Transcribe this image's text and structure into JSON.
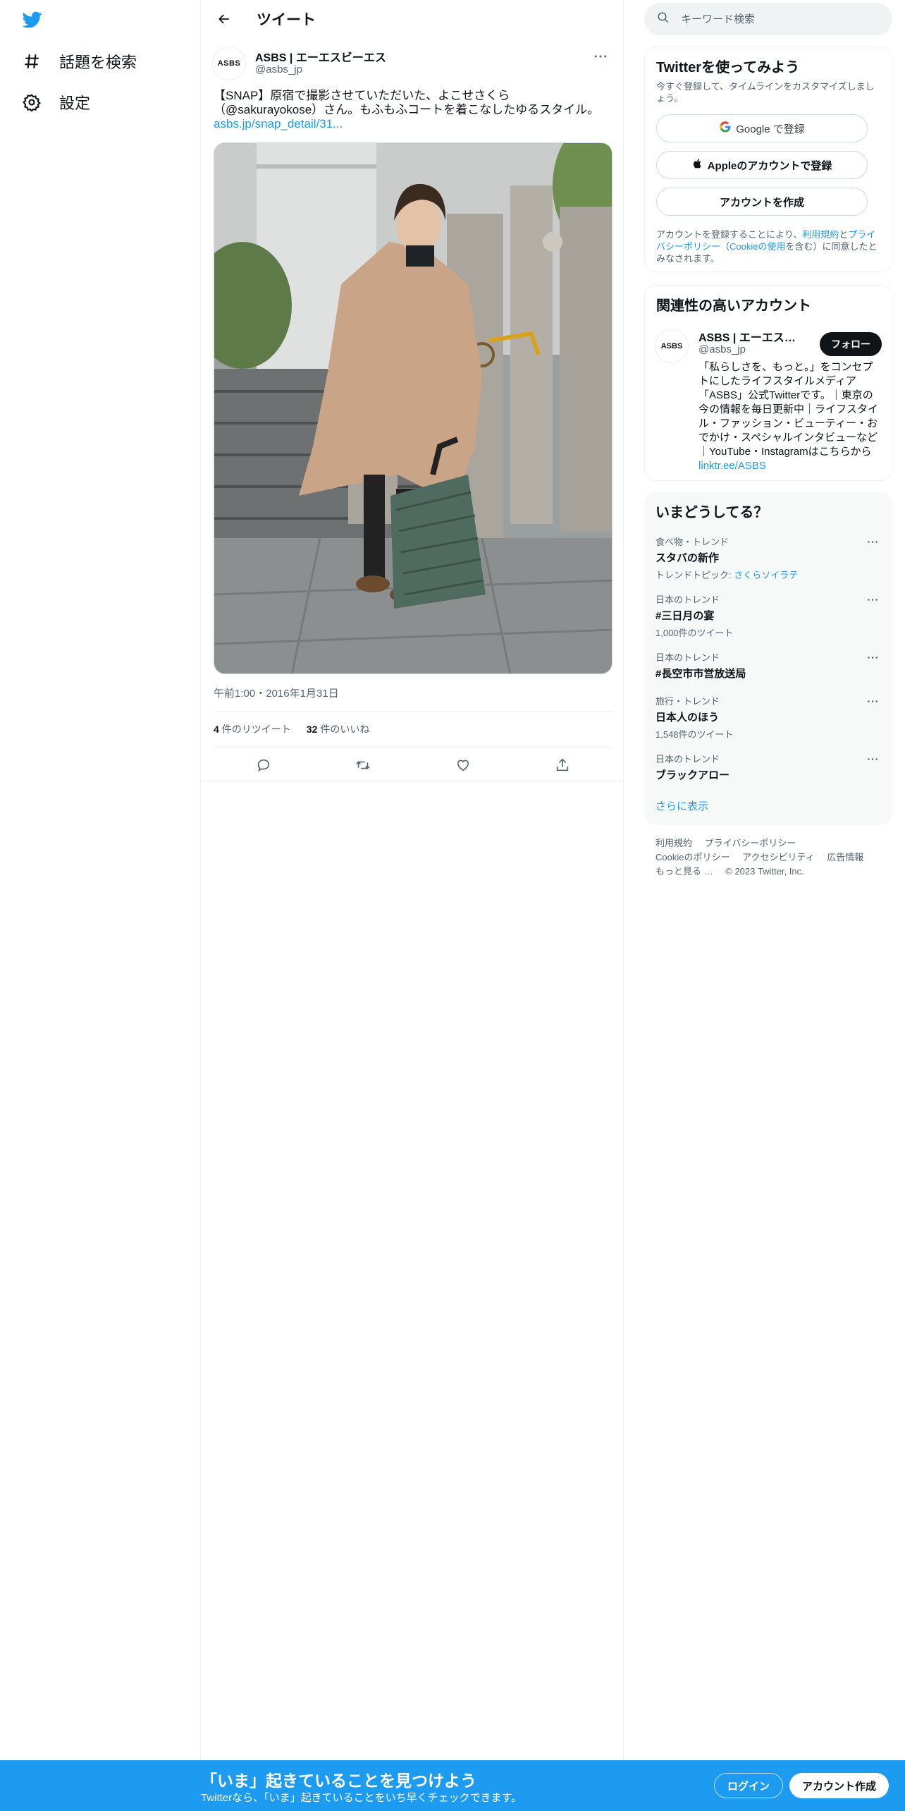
{
  "nav": {
    "items": [
      {
        "label": "話題を検索",
        "icon": "hashtag-icon"
      },
      {
        "label": "設定",
        "icon": "gear-icon"
      }
    ]
  },
  "header": {
    "title": "ツイート"
  },
  "tweet": {
    "author_name": "ASBS | エーエスビーエス",
    "author_handle": "@asbs_jp",
    "avatar_text": "ASBS",
    "text": "【SNAP】原宿で撮影させていただいた、よこせさくら（@sakurayokose）さん。もふもふコートを着こなしたゆるスタイル。",
    "link": "asbs.jp/snap_detail/31...",
    "timestamp": "午前1:00・2016年1月31日",
    "retweets_count": "4",
    "retweets_label": "件のリツイート",
    "likes_count": "32",
    "likes_label": "件のいいね"
  },
  "search": {
    "placeholder": "キーワード検索"
  },
  "signup_card": {
    "title": "Twitterを使ってみよう",
    "subtitle": "今すぐ登録して、タイムラインをカスタマイズしましょう。",
    "google_label": "Google で登録",
    "apple_label": "Appleのアカウントで登録",
    "create_label": "アカウントを作成",
    "terms_prefix": "アカウントを登録することにより、",
    "terms_link": "利用規約",
    "terms_and": "と",
    "privacy_link": "プライバシーポリシー",
    "paren_open": "（",
    "cookie_link": "Cookieの使用",
    "terms_suffix": "を含む）に同意したとみなされます。"
  },
  "related": {
    "title": "関連性の高いアカウント",
    "name": "ASBS | エーエスビ...",
    "handle": "@asbs_jp",
    "avatar_text": "ASBS",
    "follow_label": "フォロー",
    "bio": "「私らしさを、もっと。」をコンセプトにしたライフスタイルメディア「ASBS」公式Twitterです。｜東京の今の情報を毎日更新中｜ライフスタイル・ファッション・ビューティー・おでかけ・スペシャルインタビューなど｜YouTube・Instagramはこちらから",
    "bio_link": "linktr.ee/ASBS"
  },
  "trends": {
    "title": "いまどうしてる？",
    "items": [
      {
        "meta": "食べ物・トレンド",
        "name": "スタバの新作",
        "extra_prefix": "トレンドトピック: ",
        "extra_link": "さくらソイラテ",
        "count": ""
      },
      {
        "meta": "日本のトレンド",
        "name": "#三日月の宴",
        "count": "1,000件のツイート"
      },
      {
        "meta": "日本のトレンド",
        "name": "#長空市市営放送局",
        "count": ""
      },
      {
        "meta": "旅行・トレンド",
        "name": "日本人のほう",
        "count": "1,548件のツイート"
      },
      {
        "meta": "日本のトレンド",
        "name": "ブラックアロー",
        "count": ""
      }
    ],
    "show_more": "さらに表示"
  },
  "footer": {
    "links": [
      "利用規約",
      "プライバシーポリシー",
      "Cookieのポリシー",
      "アクセシビリティ",
      "広告情報",
      "もっと見る …"
    ],
    "copyright": "© 2023 Twitter, Inc."
  },
  "banner": {
    "title": "「いま」起きていることを見つけよう",
    "subtitle": "Twitterなら、「いま」起きていることをいち早くチェックできます。",
    "login_label": "ログイン",
    "signup_label": "アカウント作成"
  },
  "colors": {
    "accent": "#1d9bf0",
    "text": "#0f1419",
    "muted": "#536471"
  }
}
